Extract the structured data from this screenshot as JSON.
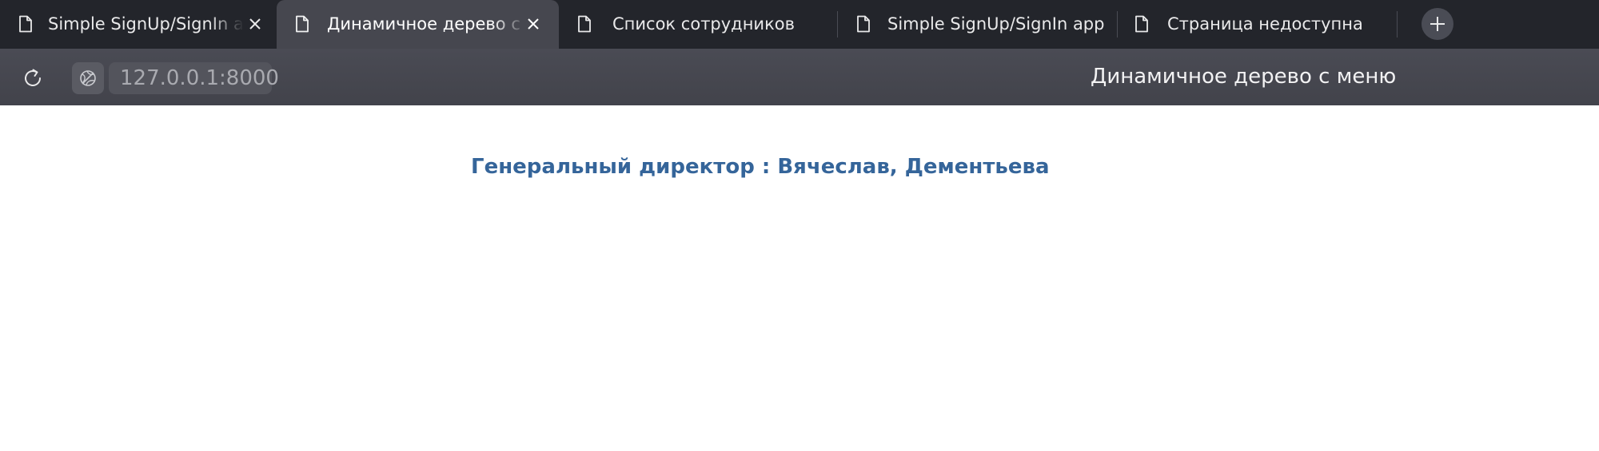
{
  "browser": {
    "tabs": [
      {
        "label": "Simple SignUp/SignIn app",
        "active": false,
        "closable": true
      },
      {
        "label": "Динамичное дерево с меню",
        "active": true,
        "closable": true
      },
      {
        "label": "Список сотрудников",
        "active": false,
        "closable": false
      },
      {
        "label": "Simple SignUp/SignIn app",
        "active": false,
        "closable": false
      },
      {
        "label": "Страница недоступна",
        "active": false,
        "closable": false
      }
    ],
    "address": "127.0.0.1:8000",
    "page_title": "Динамичное дерево с меню"
  },
  "page": {
    "heading": "Генеральный директор : Вячеслав, Дементьева"
  },
  "colors": {
    "tabbar_bg": "#23252b",
    "active_tab_bg": "#46474f",
    "toolbar_bg": "#46474f",
    "heading_color": "#35659a"
  },
  "icons": {
    "tab": "document-icon",
    "close": "close-icon",
    "new_tab": "plus-icon",
    "reload": "reload-icon",
    "site_info": "globe-icon"
  }
}
